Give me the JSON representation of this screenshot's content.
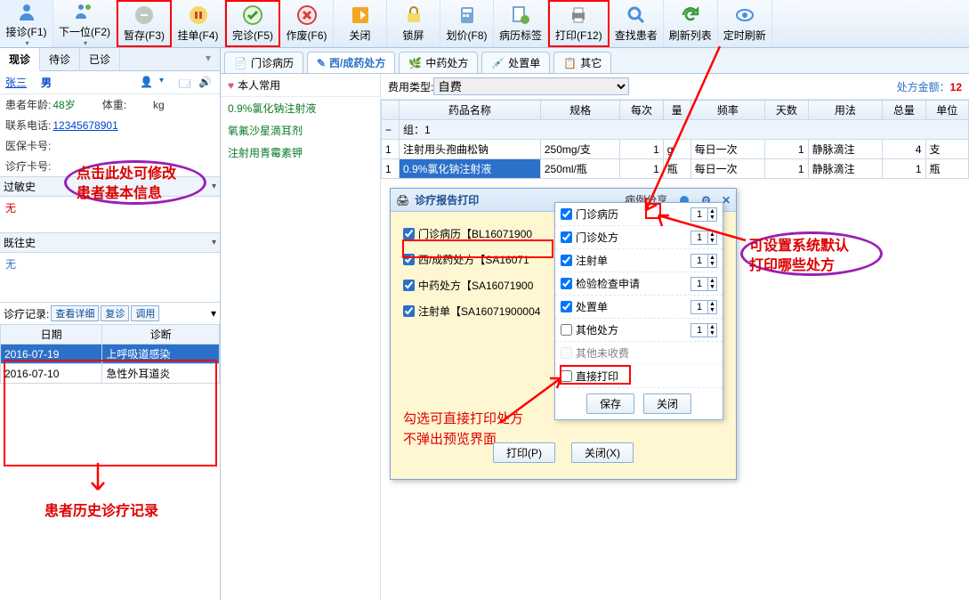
{
  "toolbar": {
    "items": [
      {
        "label": "接诊(F1)",
        "icon": "contact"
      },
      {
        "label": "下一位(F2)",
        "icon": "next"
      },
      {
        "label": "暂存(F3)",
        "icon": "pause",
        "boxed": true
      },
      {
        "label": "挂单(F4)",
        "icon": "stop"
      },
      {
        "label": "完诊(F5)",
        "icon": "check",
        "boxed": true
      },
      {
        "label": "作废(F6)",
        "icon": "cancel"
      },
      {
        "label": "关闭",
        "icon": "close"
      },
      {
        "label": "锁屏",
        "icon": "lock"
      },
      {
        "label": "划价(F8)",
        "icon": "calc"
      },
      {
        "label": "病历标签",
        "icon": "tag"
      },
      {
        "label": "打印(F12)",
        "icon": "print",
        "boxed": true
      },
      {
        "label": "查找患者",
        "icon": "search"
      },
      {
        "label": "刷新列表",
        "icon": "refresh"
      },
      {
        "label": "定时刷新",
        "icon": "eye"
      }
    ]
  },
  "left_tabs": {
    "active": "现诊",
    "items": [
      "现诊",
      "待诊",
      "已诊"
    ]
  },
  "patient": {
    "name": "张三",
    "gender": "男",
    "age_lbl": "患者年龄:",
    "age": "48岁",
    "weight_lbl": "体重:",
    "weight_unit": "kg",
    "phone_lbl": "联系电话:",
    "phone": "12345678901",
    "card_lbl": "医保卡号:",
    "visit_lbl": "诊疗卡号:"
  },
  "allergy": {
    "head": "过敏史",
    "value": "无"
  },
  "history": {
    "head": "既往史",
    "value": "无"
  },
  "visits": {
    "bar_lbl": "诊疗记录:",
    "btns": [
      "查看详细",
      "复诊",
      "调用"
    ],
    "cols": [
      "日期",
      "诊断"
    ],
    "rows": [
      {
        "date": "2016-07-19",
        "dx": "上呼吸道感染",
        "sel": true
      },
      {
        "date": "2016-07-10",
        "dx": "急性外耳道炎",
        "sel": false
      }
    ]
  },
  "right_tabs": [
    "门诊病历",
    "西/成药处方",
    "中药处方",
    "处置单",
    "其它"
  ],
  "right_active_idx": 1,
  "fav": {
    "head": "本人常用",
    "items": [
      "0.9%氯化钠注射液",
      "氧氟沙星滴耳剂",
      "注射用青霉素钾"
    ]
  },
  "fee": {
    "lbl": "费用类型:",
    "sel": "自费",
    "amt_lbl": "处方金额：",
    "amt": "12"
  },
  "grid": {
    "cols": [
      "",
      "药品名称",
      "规格",
      "每次",
      "量",
      "频率",
      "天数",
      "用法",
      "总量",
      "单位"
    ],
    "group": "组：1",
    "rows": [
      {
        "idx": "1",
        "name": "注射用头孢曲松钠",
        "spec": "250mg/支",
        "dose": "1",
        "unit": "g",
        "freq": "每日一次",
        "days": "1",
        "use": "静脉滴注",
        "tot": "4",
        "u2": "支"
      },
      {
        "idx": "1",
        "name": "0.9%氯化钠注射液",
        "spec": "250ml/瓶",
        "dose": "1",
        "unit": "瓶",
        "freq": "每日一次",
        "days": "1",
        "use": "静脉滴注",
        "tot": "1",
        "u2": "瓶",
        "sel": true
      }
    ]
  },
  "print_dlg": {
    "title": "诊疗报告打印",
    "share": "病例分享",
    "items": [
      "门诊病历【BL16071900",
      "西/成药处方【SA16071",
      "中药处方【SA16071900",
      "注射单【SA16071900004"
    ],
    "btn_print": "打印(P)",
    "btn_close": "关闭(X)"
  },
  "pref_pop": {
    "items": [
      {
        "nm": "门诊病历",
        "chk": true
      },
      {
        "nm": "门诊处方",
        "chk": true
      },
      {
        "nm": "注射单",
        "chk": true
      },
      {
        "nm": "检验检查申请",
        "chk": true
      },
      {
        "nm": "处置单",
        "chk": true
      },
      {
        "nm": "其他处方",
        "chk": false
      },
      {
        "nm": "其他未收费",
        "chk": false,
        "disabled": true
      }
    ],
    "direct": "直接打印",
    "save": "保存",
    "close": "关闭"
  },
  "annotations": {
    "edit_patient": "点击此处可修改\n患者基本信息",
    "hist_label": "患者历史诊疗记录",
    "default_print": "可设置系统默认\n打印哪些处方",
    "direct_hint": "勾选可直接打印处方\n不弹出预览界面"
  }
}
